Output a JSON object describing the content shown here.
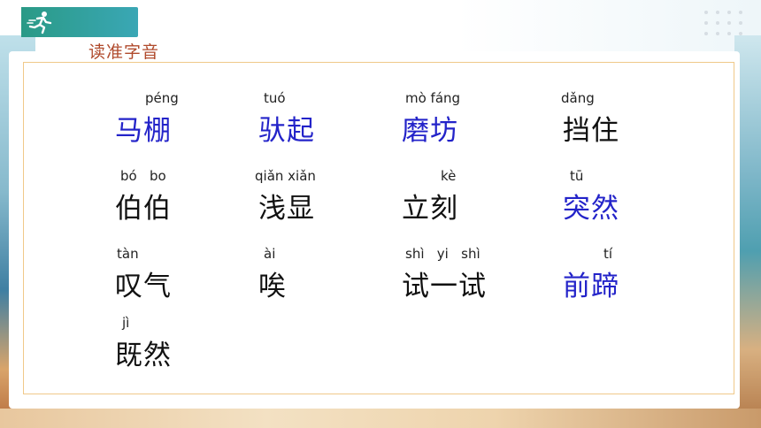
{
  "section_title": "读准字音",
  "words": [
    {
      "pinyin": "péng",
      "hanzi": "马棚",
      "highlight": true
    },
    {
      "pinyin": "tuó",
      "hanzi": "驮起",
      "highlight": true
    },
    {
      "pinyin": "mò fáng",
      "hanzi": "磨坊",
      "highlight": true
    },
    {
      "pinyin": "dǎng",
      "hanzi": "挡住",
      "highlight": false
    },
    {
      "pinyin": "bó   bo",
      "hanzi": "伯伯",
      "highlight": false
    },
    {
      "pinyin": "qiǎn xiǎn",
      "hanzi": "浅显",
      "highlight": false
    },
    {
      "pinyin": "kè",
      "hanzi": "立刻",
      "highlight": false
    },
    {
      "pinyin": "tū",
      "hanzi": "突然",
      "highlight": true
    },
    {
      "pinyin": "tàn",
      "hanzi": "叹气",
      "highlight": false
    },
    {
      "pinyin": "ài",
      "hanzi": "唉",
      "highlight": false
    },
    {
      "pinyin": "shì   yi   shì",
      "hanzi": "试一试",
      "highlight": false
    },
    {
      "pinyin": "tí",
      "hanzi": "前蹄",
      "highlight": true
    },
    {
      "pinyin": "jì",
      "hanzi": "既然",
      "highlight": false
    }
  ],
  "colors": {
    "highlight": "#2323c9",
    "normal": "#111111",
    "title": "#b04a2c",
    "header_bar": "#2a9a86",
    "frame": "#f0c98a"
  },
  "icons": {
    "header": "runner-icon",
    "corner": "dot-grid-icon"
  }
}
